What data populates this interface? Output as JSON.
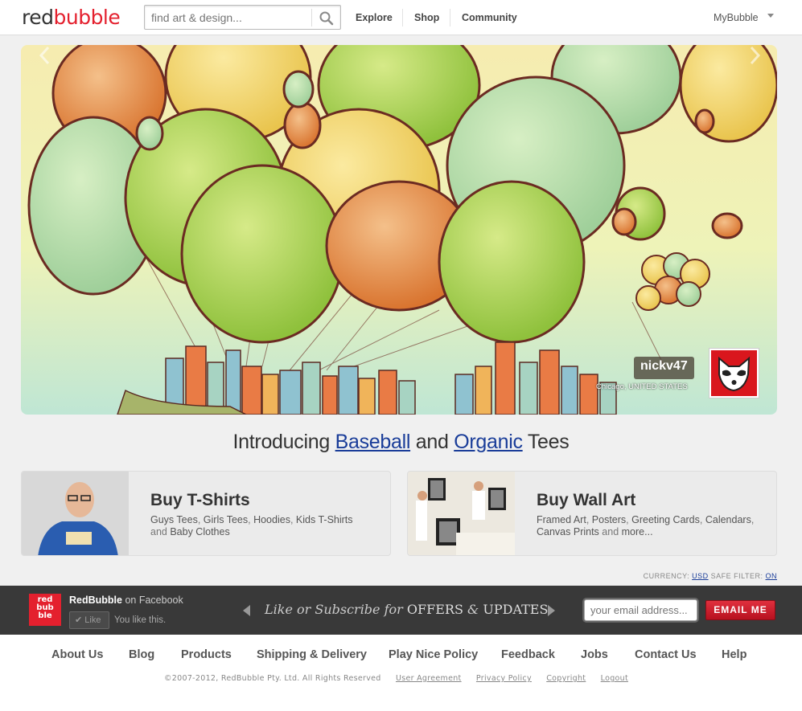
{
  "header": {
    "logo_part1": "red",
    "logo_part2": "bubble",
    "search_placeholder": "find art & design...",
    "nav": [
      "Explore",
      "Shop",
      "Community"
    ],
    "account_label": "MyBubble"
  },
  "hero": {
    "artist_name": "nickv47",
    "artist_location": "Chicago, UNITED STATES"
  },
  "headline": {
    "prefix": "Introducing",
    "link1": "Baseball",
    "middle": "and",
    "link2": "Organic",
    "suffix": "Tees"
  },
  "cards": {
    "tshirts": {
      "title": "Buy T-Shirts",
      "links": [
        "Guys Tees",
        "Girls Tees",
        "Hoodies",
        "Kids T-Shirts"
      ],
      "joiner": "and",
      "last": "Baby Clothes"
    },
    "wallart": {
      "title": "Buy Wall Art",
      "links": [
        "Framed Art",
        "Posters",
        "Greeting Cards",
        "Calendars"
      ],
      "line2_first": "Canvas Prints",
      "joiner": "and",
      "last": "more..."
    }
  },
  "prefs": {
    "currency_label": "CURRENCY:",
    "currency_value": "USD",
    "safe_label": "SAFE FILTER:",
    "safe_value": "ON"
  },
  "fbbar": {
    "logo_lines": [
      "red",
      "bub",
      "ble"
    ],
    "title": "RedBubble",
    "title_suffix": "on Facebook",
    "like_label": "Like",
    "you_like": "You like this.",
    "offer_italic": "Like or Subscribe for",
    "offer_caps1": "OFFERS",
    "offer_amp": "&",
    "offer_caps2": "UPDATES",
    "email_placeholder": "your email address...",
    "email_button": "EMAIL ME"
  },
  "footer": {
    "links": [
      "About Us",
      "Blog",
      "Products",
      "Shipping & Delivery",
      "Play Nice Policy",
      "Feedback",
      "Jobs",
      "Contact Us",
      "Help"
    ],
    "copyright": "©2007-2012, RedBubble Pty. Ltd. All Rights Reserved",
    "legal": [
      "User Agreement",
      "Privacy Policy",
      "Copyright",
      "Logout"
    ]
  },
  "colors": {
    "brand_red": "#e4202e",
    "link_blue": "#1a3d99"
  },
  "icons": [
    "search-icon",
    "chevron-down-icon",
    "chevron-left-icon",
    "chevron-right-icon",
    "facebook-like-icon"
  ]
}
